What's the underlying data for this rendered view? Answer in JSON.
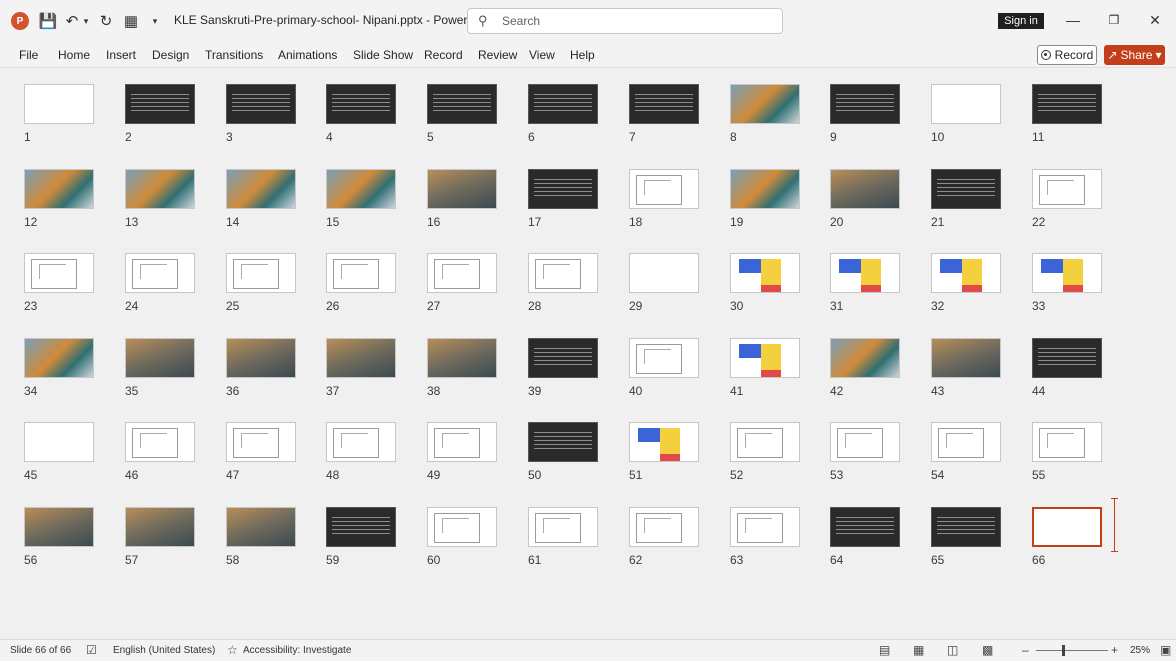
{
  "titlebar": {
    "app_logo": "P",
    "doc_title": "KLE Sanskruti-Pre-primary-school- Nipani.pptx  -  PowerP...",
    "search_placeholder": "Search",
    "signin_label": "Sign in"
  },
  "ribbon": {
    "tabs": [
      "File",
      "Home",
      "Insert",
      "Design",
      "Transitions",
      "Animations",
      "Slide Show",
      "Record",
      "Review",
      "View",
      "Help"
    ],
    "record_label": "Record",
    "share_label": "Share"
  },
  "slides": [
    {
      "n": "1",
      "kind": "text"
    },
    {
      "n": "2",
      "kind": "dark"
    },
    {
      "n": "3",
      "kind": "dark"
    },
    {
      "n": "4",
      "kind": "dark"
    },
    {
      "n": "5",
      "kind": "dark"
    },
    {
      "n": "6",
      "kind": "dark"
    },
    {
      "n": "7",
      "kind": "dark"
    },
    {
      "n": "8",
      "kind": "photo"
    },
    {
      "n": "9",
      "kind": "dark"
    },
    {
      "n": "10",
      "kind": "text"
    },
    {
      "n": "11",
      "kind": "dark"
    },
    {
      "n": "12",
      "kind": "photo"
    },
    {
      "n": "13",
      "kind": "photo"
    },
    {
      "n": "14",
      "kind": "photo"
    },
    {
      "n": "15",
      "kind": "photo"
    },
    {
      "n": "16",
      "kind": "photo2"
    },
    {
      "n": "17",
      "kind": "dark"
    },
    {
      "n": "18",
      "kind": "plan"
    },
    {
      "n": "19",
      "kind": "photo"
    },
    {
      "n": "20",
      "kind": "photo2"
    },
    {
      "n": "21",
      "kind": "dark"
    },
    {
      "n": "22",
      "kind": "plan"
    },
    {
      "n": "23",
      "kind": "plan"
    },
    {
      "n": "24",
      "kind": "plan"
    },
    {
      "n": "25",
      "kind": "plan"
    },
    {
      "n": "26",
      "kind": "plan"
    },
    {
      "n": "27",
      "kind": "plan"
    },
    {
      "n": "28",
      "kind": "plan"
    },
    {
      "n": "29",
      "kind": "text"
    },
    {
      "n": "30",
      "kind": "color"
    },
    {
      "n": "31",
      "kind": "color"
    },
    {
      "n": "32",
      "kind": "color"
    },
    {
      "n": "33",
      "kind": "color"
    },
    {
      "n": "34",
      "kind": "photo"
    },
    {
      "n": "35",
      "kind": "photo2"
    },
    {
      "n": "36",
      "kind": "photo2"
    },
    {
      "n": "37",
      "kind": "photo2"
    },
    {
      "n": "38",
      "kind": "photo2"
    },
    {
      "n": "39",
      "kind": "dark"
    },
    {
      "n": "40",
      "kind": "plan"
    },
    {
      "n": "41",
      "kind": "color"
    },
    {
      "n": "42",
      "kind": "photo"
    },
    {
      "n": "43",
      "kind": "photo2"
    },
    {
      "n": "44",
      "kind": "dark"
    },
    {
      "n": "45",
      "kind": "text"
    },
    {
      "n": "46",
      "kind": "plan"
    },
    {
      "n": "47",
      "kind": "plan"
    },
    {
      "n": "48",
      "kind": "plan"
    },
    {
      "n": "49",
      "kind": "plan"
    },
    {
      "n": "50",
      "kind": "dark"
    },
    {
      "n": "51",
      "kind": "color"
    },
    {
      "n": "52",
      "kind": "plan"
    },
    {
      "n": "53",
      "kind": "plan"
    },
    {
      "n": "54",
      "kind": "plan"
    },
    {
      "n": "55",
      "kind": "plan"
    },
    {
      "n": "56",
      "kind": "photo2"
    },
    {
      "n": "57",
      "kind": "photo2"
    },
    {
      "n": "58",
      "kind": "photo2"
    },
    {
      "n": "59",
      "kind": "dark"
    },
    {
      "n": "60",
      "kind": "plan"
    },
    {
      "n": "61",
      "kind": "plan"
    },
    {
      "n": "62",
      "kind": "plan"
    },
    {
      "n": "63",
      "kind": "plan"
    },
    {
      "n": "64",
      "kind": "dark"
    },
    {
      "n": "65",
      "kind": "dark"
    },
    {
      "n": "66",
      "kind": "text",
      "selected": true
    }
  ],
  "statusbar": {
    "slide_counter": "Slide 66 of 66",
    "language": "English (United States)",
    "accessibility": "Accessibility: Investigate",
    "zoom": "25%"
  },
  "colors": {
    "accent": "#c43e1c",
    "ppt_logo": "#d35230"
  }
}
